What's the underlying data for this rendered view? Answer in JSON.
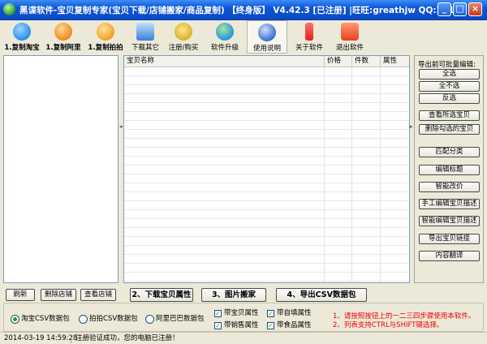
{
  "window": {
    "title": "黑谍软件-宝贝复制专家(宝贝下载/店铺搬家/商品复制) 【终身版】 V4.42.3 [已注册] |旺旺:greathjw QQ:231...",
    "minimize_glyph": "_",
    "maximize_glyph": "□",
    "close_glyph": "×"
  },
  "toolbar": {
    "items": [
      {
        "label": "1.复制淘宝",
        "icon": "taobao-icon",
        "color": "#2b8ef0"
      },
      {
        "label": "1.复制阿里",
        "icon": "alibaba-icon",
        "color": "#f08a1a"
      },
      {
        "label": "1.复制拍拍",
        "icon": "paipai-icon",
        "color": "#f0a020"
      },
      {
        "label": "下载其它",
        "icon": "computer-icon",
        "color": "#3a7fd8"
      },
      {
        "label": "注册/购买",
        "icon": "keys-icon",
        "color": "#d8b030"
      },
      {
        "label": "软件升级",
        "icon": "globe-icon",
        "color": "#2e9ad8"
      },
      {
        "label": "使用说明",
        "icon": "help-icon",
        "color": "#3a6fd0"
      },
      {
        "label": "关于软件",
        "icon": "exclamation-icon",
        "color": "#e02020"
      },
      {
        "label": "退出软件",
        "icon": "power-icon",
        "color": "#e84020"
      }
    ]
  },
  "grid": {
    "columns": [
      "宝贝名称",
      "价格",
      "件数",
      "属性"
    ]
  },
  "right_panel": {
    "title": "导出前可批量编辑:",
    "buttons": [
      "全选",
      "全不选",
      "反选",
      "查看所选宝贝",
      "删除勾选的宝贝",
      "匹配分类",
      "编辑标题",
      "智能改价",
      "手工编辑宝贝描述",
      "智能编辑宝贝描述",
      "导出宝贝链接",
      "内容翻译"
    ]
  },
  "bottom": {
    "refresh": "刷新",
    "delete_shop": "删除店铺",
    "view_shop": "查看店铺",
    "step2": "2、下载宝贝属性",
    "step3": "3、图片搬家",
    "step4": "4、导出CSV数据包"
  },
  "options": {
    "radios": [
      {
        "label": "淘宝CSV数据包",
        "checked": true
      },
      {
        "label": "拍拍CSV数据包",
        "checked": false
      },
      {
        "label": "阿里巴巴数据包",
        "checked": false
      }
    ],
    "checks": [
      {
        "label": "带宝贝属性",
        "checked": true
      },
      {
        "label": "带自填属性",
        "checked": true
      },
      {
        "label": "带销售属性",
        "checked": true
      },
      {
        "label": "带食品属性",
        "checked": true
      }
    ],
    "check_glyph": "✓",
    "notes": [
      "1、请按照按钮上的一二三四步骤使用本软件。",
      "2、列表支持CTRL与SHIFT键选择。"
    ]
  },
  "status": {
    "datetime": "2014-03-19 14:59:28",
    "message": "注册验证成功，您的电脑已注册！"
  },
  "splitter_glyph": "◂",
  "splitter_glyph_right": "▸"
}
